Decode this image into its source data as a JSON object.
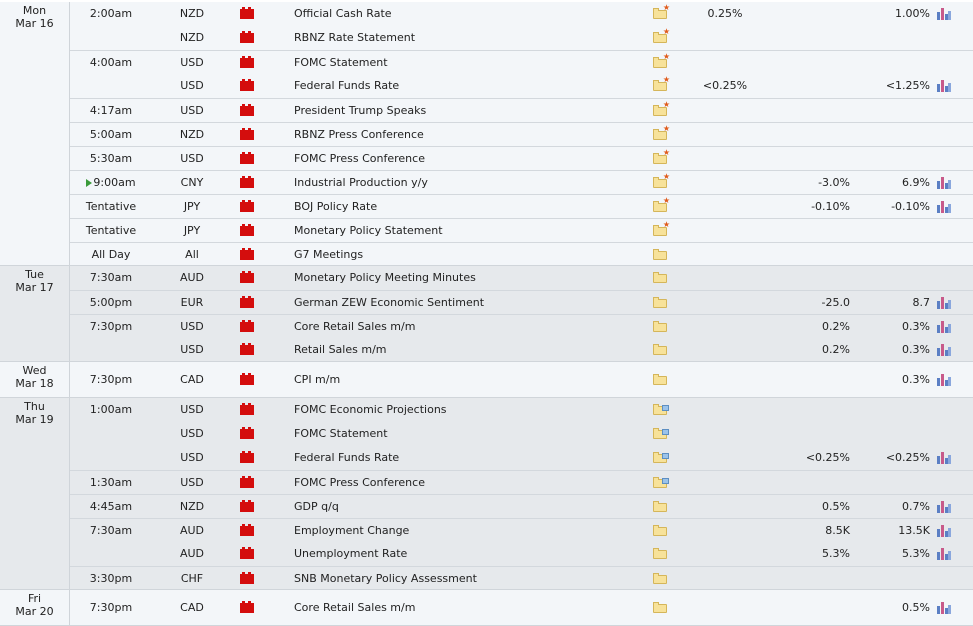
{
  "colors": {
    "importance_high": "#d40d0d",
    "band_light": "#f3f6f9",
    "band_dark": "#e6e9ec",
    "current_marker": "#3a9a3a"
  },
  "days": [
    {
      "label_line1": "Mon",
      "label_line2": "Mar 16",
      "rows": [
        {
          "time": "2:00am",
          "currency": "NZD",
          "event": "Official Cash Rate",
          "actual": "0.25%",
          "forecast": "",
          "previous": "1.00%",
          "icon": "folder-star",
          "has_chart": true,
          "gap_line": false
        },
        {
          "time": "",
          "currency": "NZD",
          "event": "RBNZ Rate Statement",
          "actual": "",
          "forecast": "",
          "previous": "",
          "icon": "folder-star",
          "has_chart": false,
          "gap_line": false
        },
        {
          "time": "4:00am",
          "currency": "USD",
          "event": "FOMC Statement",
          "actual": "",
          "forecast": "",
          "previous": "",
          "icon": "folder-star",
          "has_chart": false,
          "gap_line": true
        },
        {
          "time": "",
          "currency": "USD",
          "event": "Federal Funds Rate",
          "actual": "<0.25%",
          "forecast": "",
          "previous": "<1.25%",
          "icon": "folder-star",
          "has_chart": true,
          "gap_line": false
        },
        {
          "time": "4:17am",
          "currency": "USD",
          "event": "President Trump Speaks",
          "actual": "",
          "forecast": "",
          "previous": "",
          "icon": "folder-star",
          "has_chart": false,
          "gap_line": true
        },
        {
          "time": "5:00am",
          "currency": "NZD",
          "event": "RBNZ Press Conference",
          "actual": "",
          "forecast": "",
          "previous": "",
          "icon": "folder-star",
          "has_chart": false,
          "gap_line": true
        },
        {
          "time": "5:30am",
          "currency": "USD",
          "event": "FOMC Press Conference",
          "actual": "",
          "forecast": "",
          "previous": "",
          "icon": "folder-star",
          "has_chart": false,
          "gap_line": true
        },
        {
          "time": "9:00am",
          "currency": "CNY",
          "event": "Industrial Production y/y",
          "actual": "",
          "forecast": "-3.0%",
          "previous": "6.9%",
          "icon": "folder-star",
          "has_chart": true,
          "gap_line": true,
          "current": true
        },
        {
          "time": "Tentative",
          "currency": "JPY",
          "event": "BOJ Policy Rate",
          "actual": "",
          "forecast": "-0.10%",
          "previous": "-0.10%",
          "icon": "folder-star",
          "has_chart": true,
          "gap_line": true
        },
        {
          "time": "Tentative",
          "currency": "JPY",
          "event": "Monetary Policy Statement",
          "actual": "",
          "forecast": "",
          "previous": "",
          "icon": "folder-star",
          "has_chart": false,
          "gap_line": true
        },
        {
          "time": "All Day",
          "currency": "All",
          "event": "G7 Meetings",
          "actual": "",
          "forecast": "",
          "previous": "",
          "icon": "folder",
          "has_chart": false,
          "gap_line": true
        }
      ]
    },
    {
      "label_line1": "Tue",
      "label_line2": "Mar 17",
      "rows": [
        {
          "time": "7:30am",
          "currency": "AUD",
          "event": "Monetary Policy Meeting Minutes",
          "actual": "",
          "forecast": "",
          "previous": "",
          "icon": "folder",
          "has_chart": false,
          "gap_line": false
        },
        {
          "time": "5:00pm",
          "currency": "EUR",
          "event": "German ZEW Economic Sentiment",
          "actual": "",
          "forecast": "-25.0",
          "previous": "8.7",
          "icon": "folder",
          "has_chart": true,
          "gap_line": true
        },
        {
          "time": "7:30pm",
          "currency": "USD",
          "event": "Core Retail Sales m/m",
          "actual": "",
          "forecast": "0.2%",
          "previous": "0.3%",
          "icon": "folder",
          "has_chart": true,
          "gap_line": true
        },
        {
          "time": "",
          "currency": "USD",
          "event": "Retail Sales m/m",
          "actual": "",
          "forecast": "0.2%",
          "previous": "0.3%",
          "icon": "folder",
          "has_chart": true,
          "gap_line": false
        }
      ]
    },
    {
      "label_line1": "Wed",
      "label_line2": "Mar 18",
      "rows": [
        {
          "time": "7:30pm",
          "currency": "CAD",
          "event": "CPI m/m",
          "actual": "",
          "forecast": "",
          "previous": "0.3%",
          "icon": "folder",
          "has_chart": true,
          "gap_line": false
        }
      ]
    },
    {
      "label_line1": "Thu",
      "label_line2": "Mar 19",
      "rows": [
        {
          "time": "1:00am",
          "currency": "USD",
          "event": "FOMC Economic Projections",
          "actual": "",
          "forecast": "",
          "previous": "",
          "icon": "folder-doc",
          "has_chart": false,
          "gap_line": false
        },
        {
          "time": "",
          "currency": "USD",
          "event": "FOMC Statement",
          "actual": "",
          "forecast": "",
          "previous": "",
          "icon": "folder-doc",
          "has_chart": false,
          "gap_line": false
        },
        {
          "time": "",
          "currency": "USD",
          "event": "Federal Funds Rate",
          "actual": "",
          "forecast": "<0.25%",
          "previous": "<0.25%",
          "icon": "folder-doc",
          "has_chart": true,
          "gap_line": false
        },
        {
          "time": "1:30am",
          "currency": "USD",
          "event": "FOMC Press Conference",
          "actual": "",
          "forecast": "",
          "previous": "",
          "icon": "folder-doc",
          "has_chart": false,
          "gap_line": true
        },
        {
          "time": "4:45am",
          "currency": "NZD",
          "event": "GDP q/q",
          "actual": "",
          "forecast": "0.5%",
          "previous": "0.7%",
          "icon": "folder",
          "has_chart": true,
          "gap_line": true
        },
        {
          "time": "7:30am",
          "currency": "AUD",
          "event": "Employment Change",
          "actual": "",
          "forecast": "8.5K",
          "previous": "13.5K",
          "icon": "folder",
          "has_chart": true,
          "gap_line": true
        },
        {
          "time": "",
          "currency": "AUD",
          "event": "Unemployment Rate",
          "actual": "",
          "forecast": "5.3%",
          "previous": "5.3%",
          "icon": "folder",
          "has_chart": true,
          "gap_line": false
        },
        {
          "time": "3:30pm",
          "currency": "CHF",
          "event": "SNB Monetary Policy Assessment",
          "actual": "",
          "forecast": "",
          "previous": "",
          "icon": "folder",
          "has_chart": false,
          "gap_line": true
        }
      ]
    },
    {
      "label_line1": "Fri",
      "label_line2": "Mar 20",
      "rows": [
        {
          "time": "7:30pm",
          "currency": "CAD",
          "event": "Core Retail Sales m/m",
          "actual": "",
          "forecast": "",
          "previous": "0.5%",
          "icon": "folder",
          "has_chart": true,
          "gap_line": false
        }
      ]
    }
  ]
}
